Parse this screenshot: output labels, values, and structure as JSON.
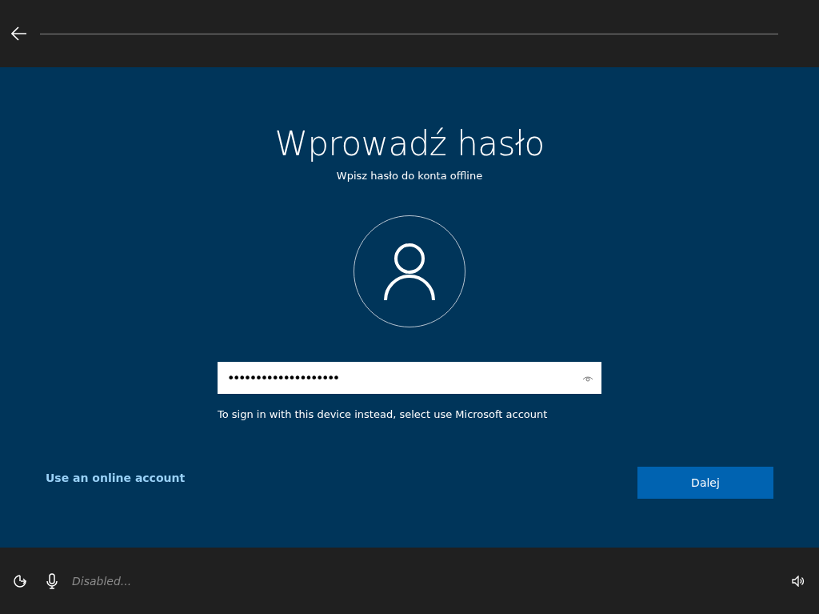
{
  "title": "Wprowadź hasło",
  "subtitle": "Wpisz hasło do konta offline",
  "password": {
    "value": "••••••••••••••••••••"
  },
  "hint": "To sign in with this device instead, select use Microsoft account",
  "online_account_link": "Use an online account",
  "next_button": "Dalej",
  "footer": {
    "status": "Disabled..."
  }
}
